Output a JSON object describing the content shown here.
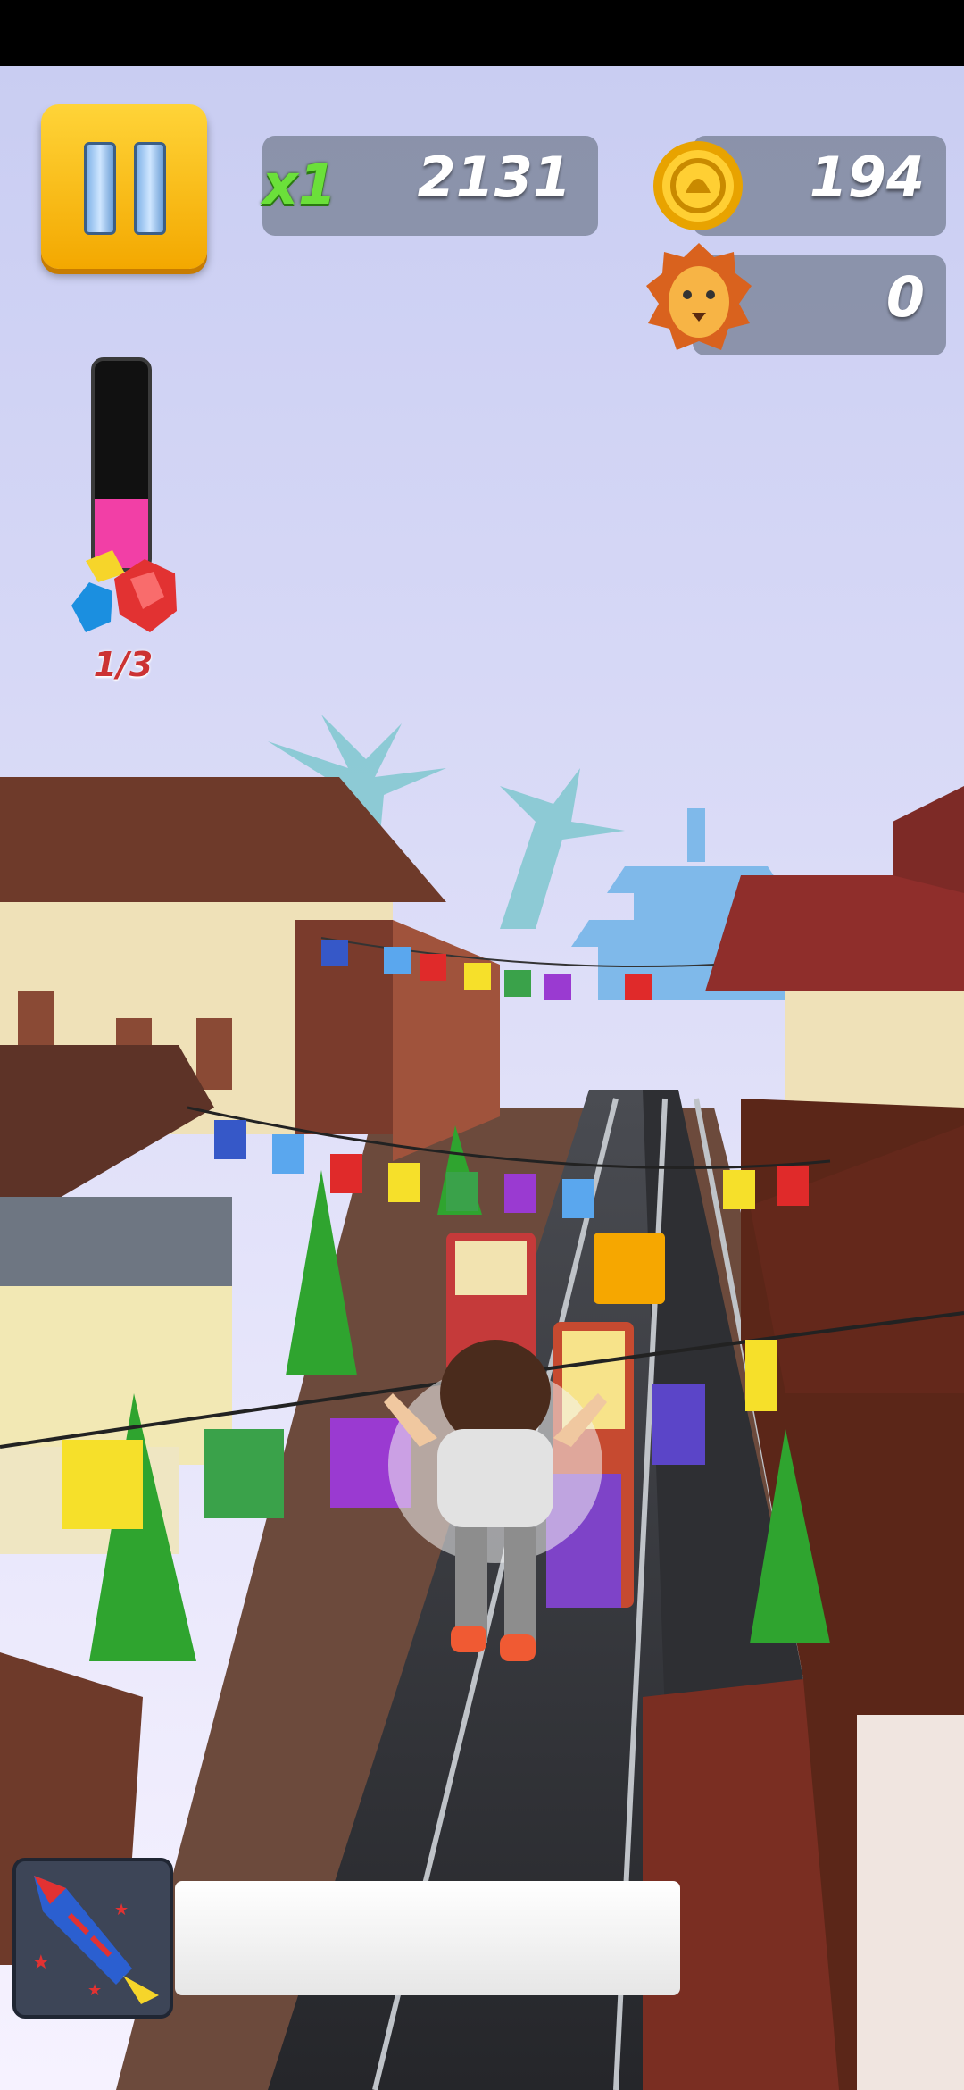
{
  "hud": {
    "pause_icon": "pause-icon",
    "multiplier": "x1",
    "score": "2131",
    "coins": "194",
    "coin_icon": "coin-icon",
    "lions": "0",
    "lion_icon": "lion-head-icon",
    "gems": {
      "label": "1/3",
      "icon": "gems-icon",
      "fill_fraction": 0.33
    },
    "powerup": {
      "icon": "firework-rocket-icon",
      "progress_fraction": 1.0
    }
  },
  "colors": {
    "pause_button": "#f7b900",
    "multiplier_text": "#6be03a",
    "gem_meter_fill": "#f23fa6",
    "panel_bg": "#788296",
    "sky_top": "#c9cdf2",
    "sky_bottom": "#f6f2ff",
    "road": "#2f3033",
    "roof": "#6e3a2a"
  }
}
